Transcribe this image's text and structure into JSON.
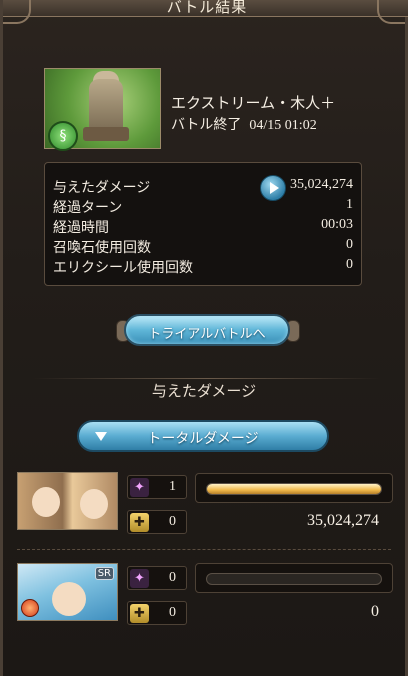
{
  "window": {
    "title": "バトル結果"
  },
  "enemy": {
    "name": "エクストリーム・木人＋",
    "status": "バトル終了",
    "date": "04/15 01:02",
    "element_icon": "wind-element-icon"
  },
  "stats": [
    {
      "label": "与えたダメージ",
      "value": "35,024,274"
    },
    {
      "label": "経過ターン",
      "value": "1"
    },
    {
      "label": "経過時間",
      "value": "00:03"
    },
    {
      "label": "召喚石使用回数",
      "value": "0"
    },
    {
      "label": "エリクシール使用回数",
      "value": "0"
    }
  ],
  "trial_button": {
    "label": "トライアルバトルへ"
  },
  "damage_section": {
    "heading": "与えたダメージ",
    "dropdown_label": "トータルダメージ"
  },
  "party": [
    {
      "star_count": "1",
      "cross_count": "0",
      "damage": "35,024,274",
      "damage_fraction": 1.0
    },
    {
      "badge": "SR",
      "star_count": "0",
      "cross_count": "0",
      "damage": "0",
      "damage_fraction": 0.0
    }
  ],
  "colors": {
    "accent_blue": "#5fb6d8",
    "bar_gold": "#f0b84a",
    "panel_bg": "#14110f"
  }
}
